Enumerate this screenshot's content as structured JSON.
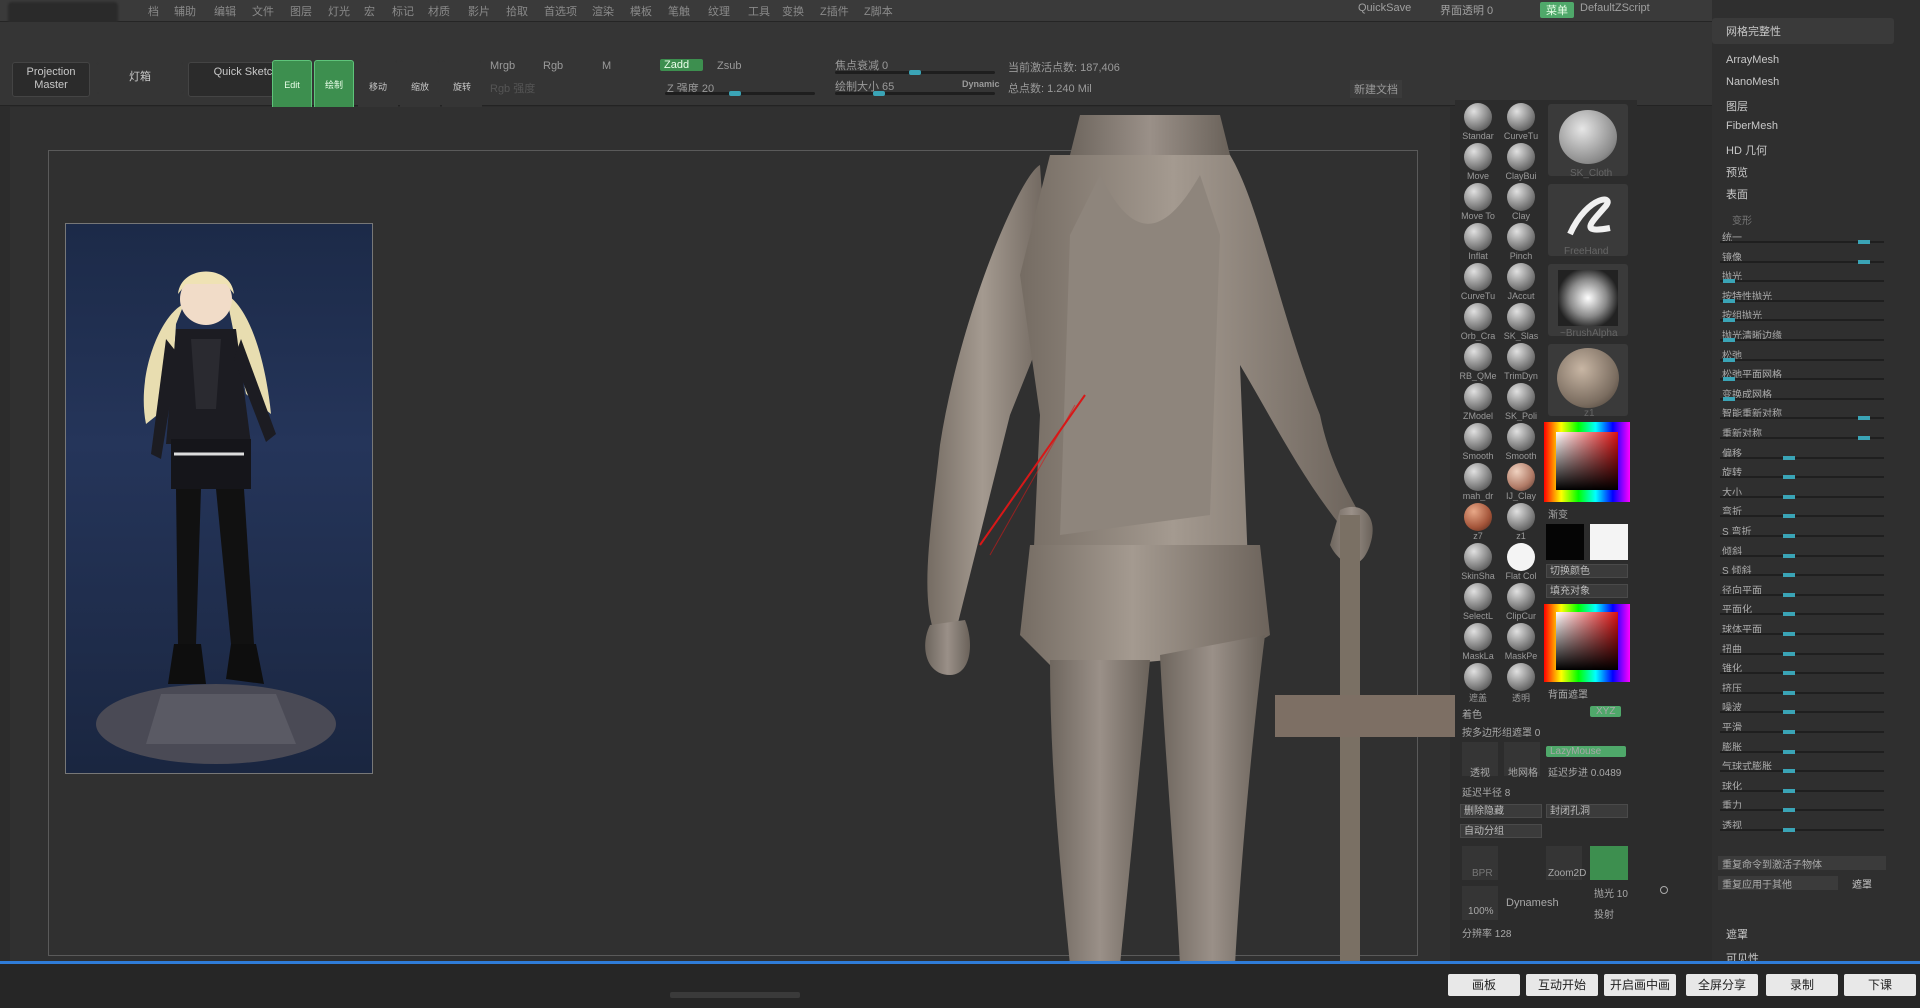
{
  "menubar": {
    "items": [
      "档",
      "辅助",
      "编辑",
      "文件",
      "图层",
      "灯光",
      "宏",
      "标记",
      "材质",
      "影片",
      "拾取",
      "首选项",
      "渲染",
      "模板",
      "笔触",
      "纹理",
      "工具",
      "变换",
      "Z插件",
      "Z脚本"
    ],
    "quicksave": "QuickSave",
    "transparency": "界面透明 0",
    "menu_label": "菜单",
    "script": "DefaultZScript"
  },
  "toolbar": {
    "projection_master": "Projection Master",
    "lightbox": "灯箱",
    "quick_sketch": "Quick Sketch",
    "edit": "Edit",
    "draw": "绘制",
    "move": "移动",
    "scale": "缩放",
    "rotate": "旋转",
    "mrgb": "Mrgb",
    "rgb": "Rgb",
    "m": "M",
    "zadd": "Zadd",
    "zsub": "Zsub",
    "rgb_intensity": "Rgb 强度",
    "z_intensity": "Z 强度 20",
    "focal_shift": "焦点衰减 0",
    "draw_size": "绘制大小 65",
    "dynamic": "Dynamic",
    "active_points": "当前激活点数: 187,406",
    "total_points": "总点数: 1.240 Mil",
    "new_doc": "新建文档"
  },
  "brushes": {
    "items": [
      "Standar",
      "CurveTu",
      "Move",
      "ClayBui",
      "Move To",
      "Clay",
      "Inflat",
      "Pinch",
      "CurveTu",
      "JAccut",
      "Orb_Cra",
      "SK_Slas",
      "RB_QMe",
      "TrimDyn",
      "ZModel",
      "SK_Poli",
      "Smooth",
      "Smooth",
      "mah_dr",
      "IJ_Clay",
      "z7",
      "z1",
      "SkinSha",
      "Flat Col",
      "SelectL",
      "ClipCur",
      "MaskLa",
      "MaskPe",
      "遮盖",
      "透明"
    ],
    "big": [
      "SK_Cloth",
      "FreeHand",
      "~BrushAlpha",
      "z1"
    ],
    "gradient": "渐变",
    "switch_color": "切换颜色",
    "fill_object": "填充对象",
    "backface_mask": "背面遮罩",
    "color_label": "着色",
    "xyz": "XYZ",
    "polygroup": "按多边形组遮罩 0",
    "perspective": "透视",
    "floor": "地网格",
    "lazymouse": "LazyMouse",
    "lazystep": "延迟步进 0.0489",
    "lazyradius": "延迟半径 8",
    "del_hidden": "删除隐藏",
    "close_holes": "封闭孔洞",
    "auto_group": "自动分组",
    "bpr": "BPR",
    "zoom2d": "Zoom2D",
    "dynamesh": "Dynamesh",
    "percent": "100%",
    "polish": "抛光 10",
    "project": "投射",
    "resolution": "分辨率 128"
  },
  "rightpanel": {
    "header": "网格完整性",
    "items": [
      "ArrayMesh",
      "NanoMesh",
      "图层",
      "FiberMesh",
      "HD 几何",
      "预览",
      "表面"
    ],
    "deform_title": "变形",
    "rows": [
      "统一",
      "镜像",
      "抛光",
      "按特性抛光",
      "按组抛光",
      "抛光清晰边缘",
      "松弛",
      "松弛平面网格",
      "变换成网格",
      "智能重新对称",
      "重新对称",
      "偏移",
      "旋转",
      "大小",
      "弯折",
      "S 弯折",
      "倾斜",
      "S 倾斜",
      "径向平面",
      "平面化",
      "球体平面",
      "扭曲",
      "锥化",
      "挤压",
      "噪波",
      "平滑",
      "膨胀",
      "气球式膨胀",
      "球化",
      "重力",
      "透视"
    ],
    "knob_pos": [
      0.92,
      0.92,
      0.02,
      0.02,
      0.02,
      0.02,
      0.02,
      0.02,
      0.02,
      0.92,
      0.92,
      0.42,
      0.42,
      0.42,
      0.42,
      0.42,
      0.42,
      0.42,
      0.42,
      0.42,
      0.42,
      0.42,
      0.42,
      0.42,
      0.42,
      0.42,
      0.42,
      0.42,
      0.42,
      0.42,
      0.42
    ],
    "repeat_active": "重复命令到激活子物体",
    "repeat_other": "重复应用于其他",
    "mask_small": "遮罩",
    "bottom_items": [
      "遮罩",
      "可见性"
    ]
  },
  "bottom": {
    "buttons": [
      "画板",
      "互动开始",
      "开启画中画",
      "全屏分享",
      "录制",
      "下课"
    ]
  }
}
